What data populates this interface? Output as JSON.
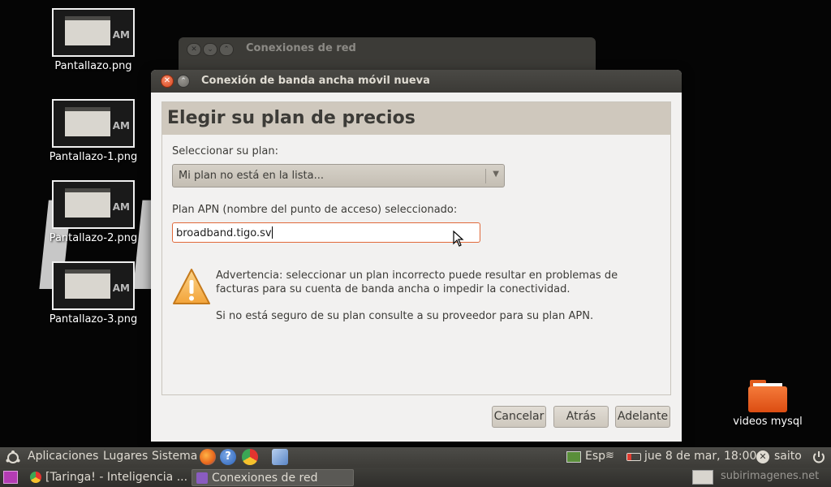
{
  "desktop": {
    "icons": [
      {
        "label": "Pantallazo.png"
      },
      {
        "label": "Pantallazo-1.png"
      },
      {
        "label": "Pantallazo-2.png"
      },
      {
        "label": "Pantallazo-3.png"
      }
    ],
    "folder": {
      "label": "videos mysql"
    },
    "wallpaper_text": "LPEAM"
  },
  "background_window": {
    "title": "Conexiones de red"
  },
  "dialog": {
    "title": "Conexión de banda ancha móvil nueva",
    "heading": "Elegir su plan de precios",
    "plan_label": "Seleccionar su plan:",
    "plan_value": "Mi plan no está en la lista...",
    "apn_label": "Plan APN (nombre del punto de acceso) seleccionado:",
    "apn_value": "broadband.tigo.sv",
    "warning": "Advertencia: seleccionar un plan incorrecto puede resultar en problemas de facturas para su cuenta de banda ancha o impedir la conectividad.",
    "hint": "Si no está seguro de su plan consulte a su proveedor para su plan APN.",
    "buttons": {
      "cancel": "Cancelar",
      "back": "Atrás",
      "forward": "Adelante"
    }
  },
  "panel": {
    "menus": {
      "applications": "Aplicaciones",
      "places": "Lugares",
      "system": "Sistema"
    },
    "keyboard": "Esp",
    "clock": "jue  8 de mar, 18:00",
    "user": "saito"
  },
  "taskbar": {
    "tasks": [
      {
        "label": "[Taringa! - Inteligencia ..."
      },
      {
        "label": "Conexiones de red"
      }
    ],
    "watermark": "subirimagenes.net"
  },
  "colors": {
    "accent": "#e0693a",
    "panel": "#3c3b37",
    "dialog_bg": "#f2f1f0",
    "header_bg": "#cfc8bd"
  }
}
